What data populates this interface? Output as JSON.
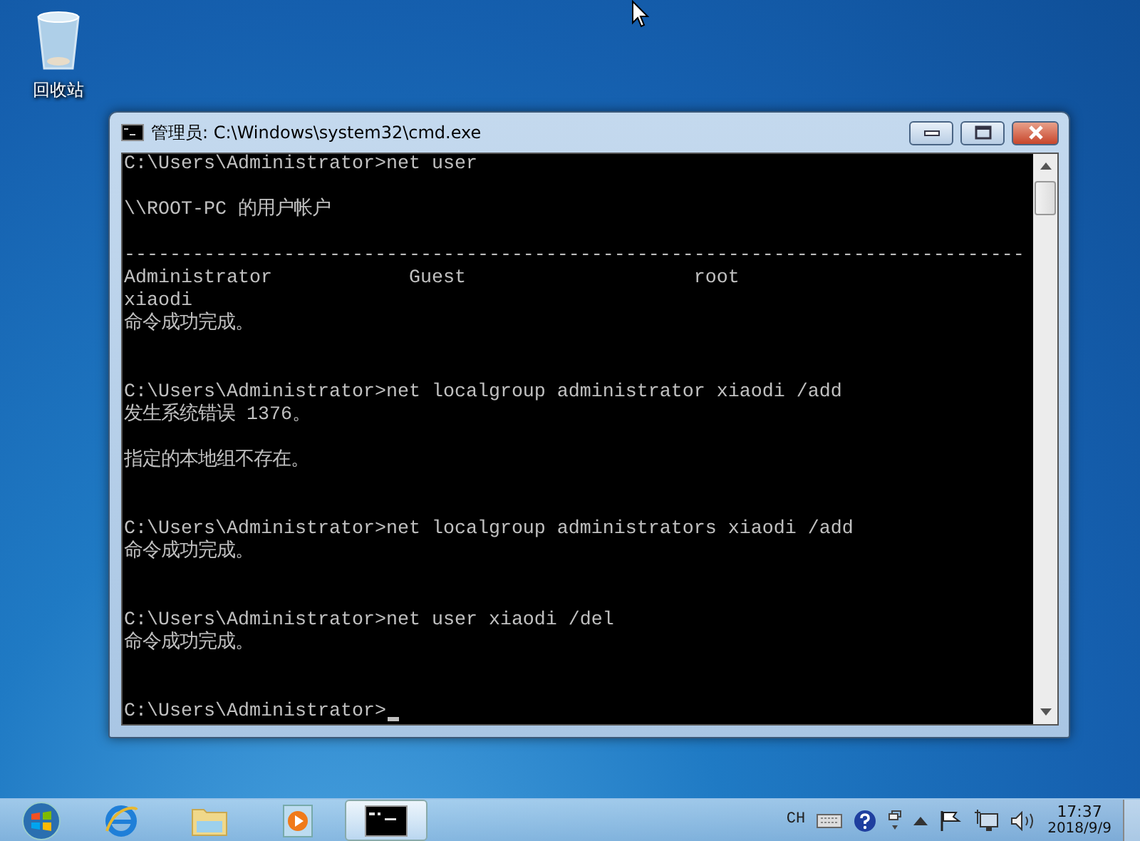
{
  "desktop_icons": [
    {
      "label": "回收站"
    }
  ],
  "window": {
    "title": "管理员: C:\\Windows\\system32\\cmd.exe",
    "cursor_visible": true,
    "console_lines": [
      {
        "kind": "text",
        "text": "C:\\Users\\Administrator>net user"
      },
      {
        "kind": "blank"
      },
      {
        "kind": "text",
        "text": "\\\\ROOT-PC 的用户帐户"
      },
      {
        "kind": "blank"
      },
      {
        "kind": "text",
        "text": "-------------------------------------------------------------------------------"
      },
      {
        "kind": "text",
        "text": "Administrator            Guest                    root"
      },
      {
        "kind": "text",
        "text": "xiaodi"
      },
      {
        "kind": "text",
        "text": "命令成功完成。"
      },
      {
        "kind": "blank"
      },
      {
        "kind": "blank"
      },
      {
        "kind": "text",
        "text": "C:\\Users\\Administrator>net localgroup administrator xiaodi /add"
      },
      {
        "kind": "text",
        "text": "发生系统错误 1376。"
      },
      {
        "kind": "blank"
      },
      {
        "kind": "text",
        "text": "指定的本地组不存在。"
      },
      {
        "kind": "blank"
      },
      {
        "kind": "blank"
      },
      {
        "kind": "text",
        "text": "C:\\Users\\Administrator>net localgroup administrators xiaodi /add"
      },
      {
        "kind": "text",
        "text": "命令成功完成。"
      },
      {
        "kind": "blank"
      },
      {
        "kind": "blank"
      },
      {
        "kind": "text",
        "text": "C:\\Users\\Administrator>net user xiaodi /del"
      },
      {
        "kind": "text",
        "text": "命令成功完成。"
      },
      {
        "kind": "blank"
      },
      {
        "kind": "blank"
      },
      {
        "kind": "text",
        "text": "C:\\Users\\Administrator>"
      }
    ]
  },
  "taskbar": {
    "apps": [
      {
        "kind": "browser",
        "selected": false
      },
      {
        "kind": "folder",
        "selected": false
      },
      {
        "kind": "media",
        "selected": false
      },
      {
        "kind": "console",
        "selected": true
      }
    ],
    "tray": {
      "language": "CH",
      "time": "17:37",
      "date": "2018/9/9"
    }
  }
}
